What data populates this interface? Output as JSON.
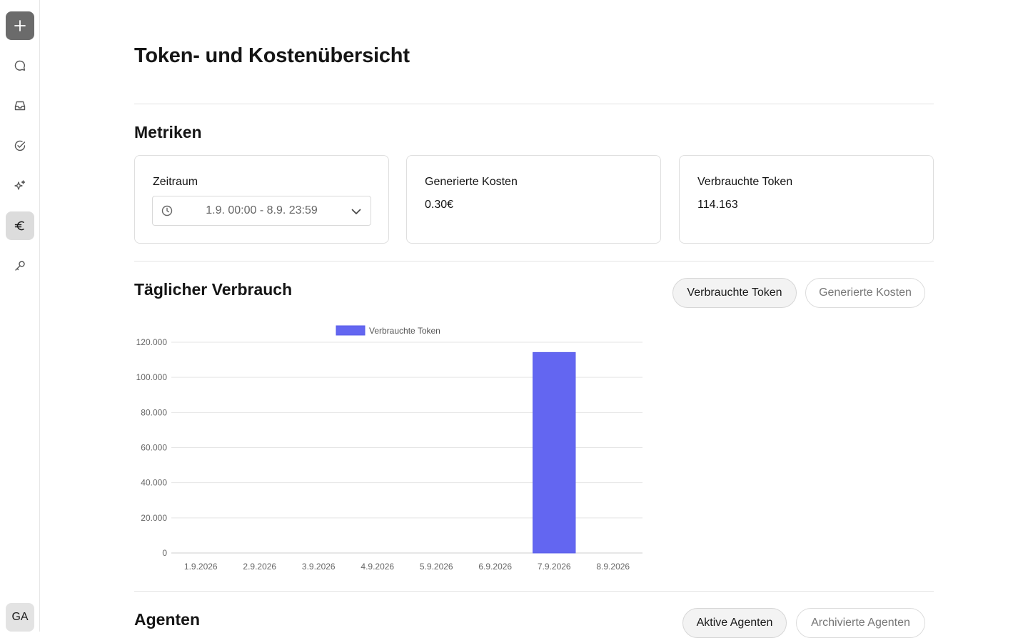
{
  "sidebar": {
    "items": [
      {
        "name": "new",
        "icon": "plus-icon"
      },
      {
        "name": "chat",
        "icon": "chat-bubble-icon"
      },
      {
        "name": "inbox",
        "icon": "inbox-icon"
      },
      {
        "name": "tasks",
        "icon": "check-circle-icon"
      },
      {
        "name": "ai",
        "icon": "sparkle-icon"
      },
      {
        "name": "costs",
        "icon": "euro-icon",
        "active": true
      },
      {
        "name": "keys",
        "icon": "key-icon"
      }
    ],
    "avatar": "GA"
  },
  "page": {
    "title": "Token- und Kostenübersicht"
  },
  "metrics": {
    "title": "Metriken",
    "period": {
      "label": "Zeitraum",
      "value": "1.9. 00:00 - 8.9. 23:59"
    },
    "cost": {
      "label": "Generierte Kosten",
      "value": "0.30€"
    },
    "tokens": {
      "label": "Verbrauchte Token",
      "value": "114.163"
    }
  },
  "daily": {
    "title": "Täglicher Verbrauch",
    "toggles": [
      {
        "label": "Verbrauchte Token",
        "selected": true
      },
      {
        "label": "Generierte Kosten",
        "selected": false
      }
    ]
  },
  "agents": {
    "title": "Agenten",
    "toggles": [
      {
        "label": "Aktive Agenten",
        "selected": true
      },
      {
        "label": "Archivierte Agenten",
        "selected": false
      }
    ]
  },
  "colors": {
    "accent": "#6366f1",
    "grid": "#e5e5e5",
    "axis_text": "#666666"
  },
  "chart_data": {
    "type": "bar",
    "categories": [
      "1.9.2026",
      "2.9.2026",
      "3.9.2026",
      "4.9.2026",
      "5.9.2026",
      "6.9.2026",
      "7.9.2026",
      "8.9.2026"
    ],
    "series": [
      {
        "name": "Verbrauchte Token",
        "values": [
          0,
          0,
          0,
          0,
          0,
          0,
          114163,
          0
        ]
      }
    ],
    "ylim": [
      0,
      120000
    ],
    "yticks": [
      0,
      20000,
      40000,
      60000,
      80000,
      100000,
      120000
    ],
    "ytick_labels": [
      "0",
      "20.000",
      "40.000",
      "60.000",
      "80.000",
      "100.000",
      "120.000"
    ],
    "grid": true,
    "legend": "top"
  }
}
